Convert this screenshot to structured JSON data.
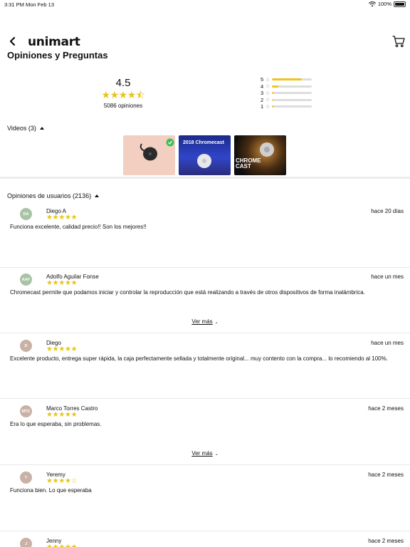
{
  "status": {
    "time": "3:31 PM",
    "date": "Mon Feb 13",
    "battery": "100%"
  },
  "header": {
    "logo": "unimart",
    "title": "Opiniones y Preguntas"
  },
  "rating": {
    "value": "4.5",
    "stars": "★★★★⯪",
    "count": "5086 opiniones",
    "histogram": [
      {
        "label": "5",
        "fill": 0.75
      },
      {
        "label": "4",
        "fill": 0.16
      },
      {
        "label": "3",
        "fill": 0.04
      },
      {
        "label": "2",
        "fill": 0.02
      },
      {
        "label": "1",
        "fill": 0.03
      }
    ]
  },
  "videos": {
    "label": "Videos (3)",
    "items": [
      {
        "caption": ""
      },
      {
        "caption": "2018 Chromecast"
      },
      {
        "caption": "CHROME\nCAST"
      }
    ]
  },
  "reviews": {
    "label": "Opiniones de usuarios (2136)",
    "more_label": "Ver más",
    "items": [
      {
        "initials": "DA",
        "color": "#a9c3a6",
        "name": "Diego A",
        "stars": "★★★★★",
        "date": "hace 20 días",
        "text": "Funciona excelente, calidad precio!! Son los mejores!!"
      },
      {
        "initials": "AAF",
        "color": "#a9c3a6",
        "name": "Adolfo Aguilar Fonse",
        "stars": "★★★★★",
        "date": "hace un mes",
        "text": "Chromecast permite que podamos iniciar y controlar la reproducción que está realizando a través de otros dispositivos de forma inalámbrica."
      },
      {
        "initials": "D",
        "color": "#c9b1a6",
        "name": "Diego",
        "stars": "★★★★★",
        "date": "hace un mes",
        "text": "Excelente producto, entrega super rápida, la caja perfectamente sellada y totalmente original...  muy contento con la compra... lo recomiendo al 100%."
      },
      {
        "initials": "MTC",
        "color": "#c9b1a6",
        "name": "Marco Torres Castro",
        "stars": "★★★★★",
        "date": "hace 2 meses",
        "text": "Era lo que esperaba, sin problemas."
      },
      {
        "initials": "Y",
        "color": "#c9b1a6",
        "name": "Yeremy",
        "stars": "★★★★☆",
        "date": "hace 2 meses",
        "text": "Funciona bien. Lo que esperaba"
      },
      {
        "initials": "J",
        "color": "#c9b1a6",
        "name": "Jenny",
        "stars": "★★★★★",
        "date": "hace 2 meses",
        "text": ""
      }
    ]
  }
}
